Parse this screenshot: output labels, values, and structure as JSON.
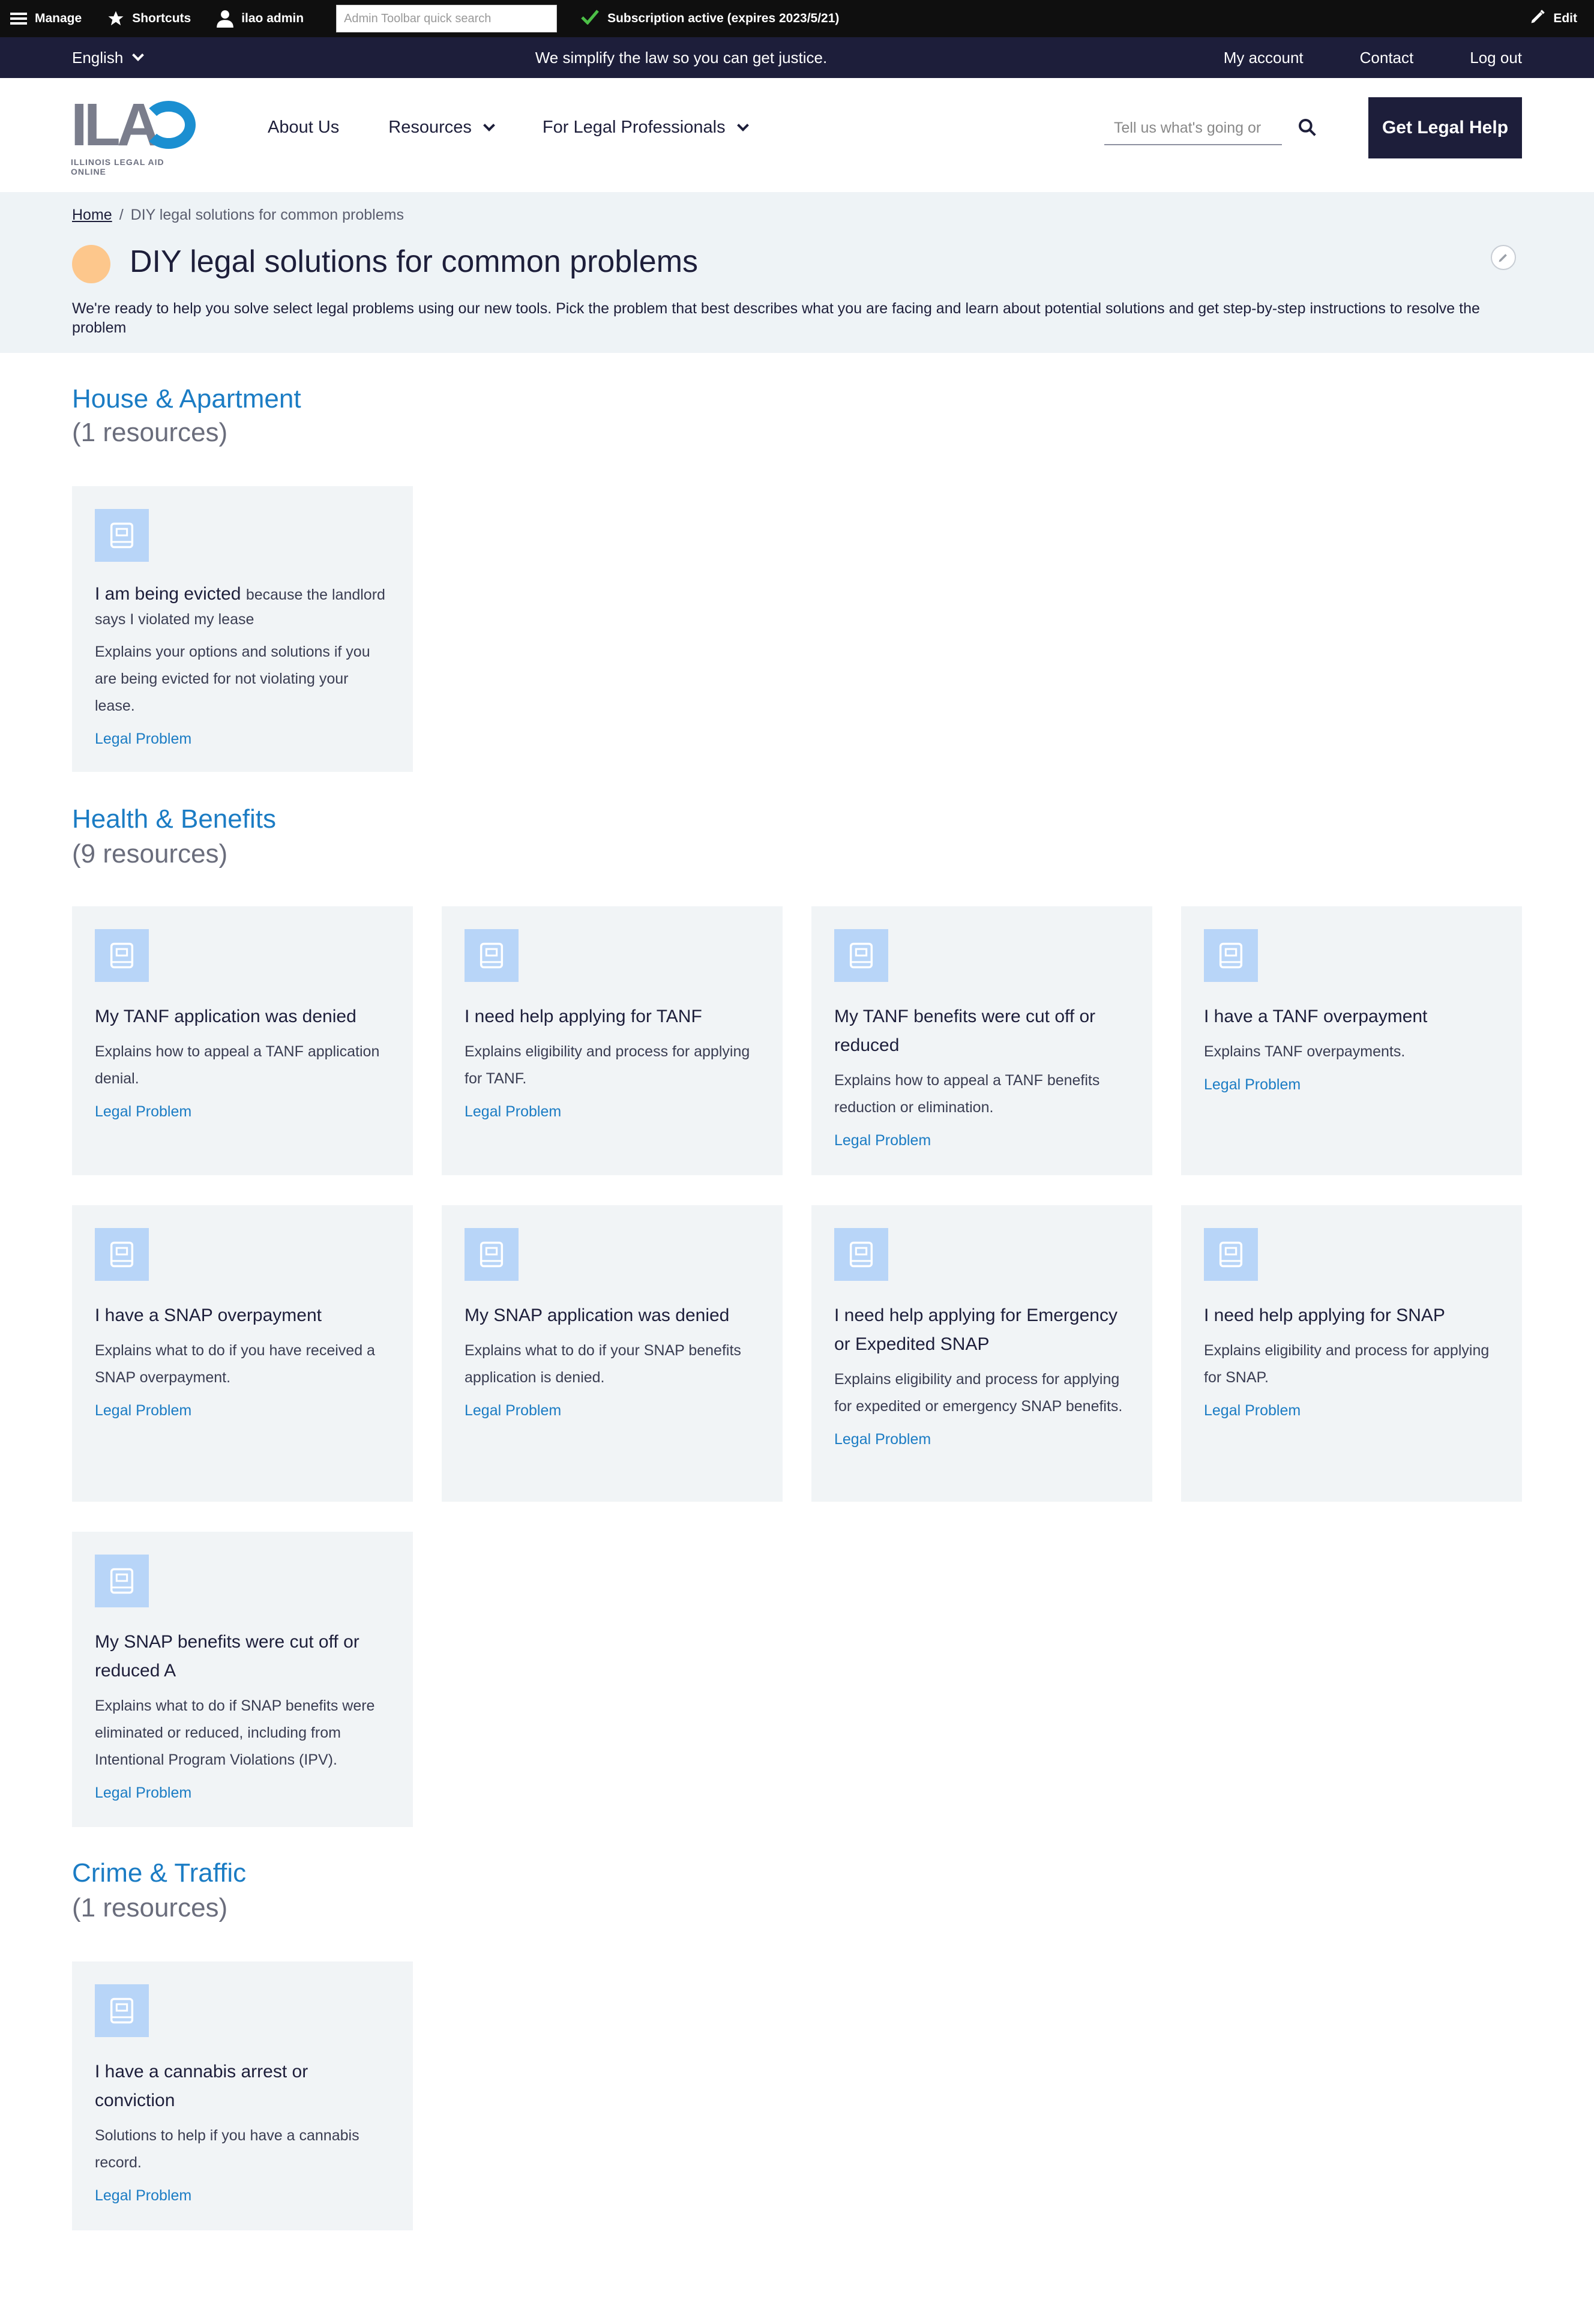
{
  "admin_toolbar": {
    "manage": "Manage",
    "shortcuts": "Shortcuts",
    "user": "ilao admin",
    "search_placeholder": "Admin Toolbar quick search",
    "subscription": "Subscription active (expires 2023/5/21)",
    "edit": "Edit"
  },
  "util_bar": {
    "language": "English",
    "tagline": "We simplify the law so you can get justice.",
    "links": [
      "My account",
      "Contact",
      "Log out"
    ]
  },
  "header": {
    "logo_mark": "ILA",
    "logo_sub": "ILLINOIS LEGAL AID ONLINE",
    "nav": [
      "About Us",
      "Resources",
      "For Legal Professionals"
    ],
    "search_placeholder": "Tell us what's going or",
    "cta": "Get Legal Help"
  },
  "hero": {
    "breadcrumb_home": "Home",
    "breadcrumb_sep": "/",
    "breadcrumb_current": "DIY legal solutions for common problems",
    "title": "DIY legal solutions for common problems",
    "description": "We're ready to help you solve select legal problems using our new tools. Pick the problem that best describes what you are facing and learn about potential solutions and get step-by-step instructions to resolve the problem"
  },
  "sections": [
    {
      "title": "House & Apartment",
      "count": "(1 resources)",
      "cards": [
        {
          "title": "I am being evicted",
          "title_small": "because the landlord says I violated my lease",
          "desc": "Explains your options and solutions if you are being evicted for not violating your lease.",
          "link": "Legal Problem"
        }
      ]
    },
    {
      "title": "Health & Benefits",
      "count": "(9 resources)",
      "cards": [
        {
          "title": "My TANF application was denied",
          "desc": "Explains how to appeal a TANF application denial.",
          "link": "Legal Problem"
        },
        {
          "title": "I need help applying for TANF",
          "desc": "Explains eligibility and process for applying for TANF.",
          "link": "Legal Problem"
        },
        {
          "title": "My TANF benefits were cut off or reduced",
          "desc": "Explains how to appeal a TANF benefits reduction or elimination.",
          "link": "Legal Problem"
        },
        {
          "title": "I have a TANF overpayment",
          "desc": "Explains TANF overpayments.",
          "link": "Legal Problem"
        },
        {
          "title": "I have a SNAP overpayment",
          "desc": "Explains what to do if you have received a SNAP overpayment.",
          "link": "Legal Problem"
        },
        {
          "title": "My SNAP application was denied",
          "desc": "Explains what to do if your SNAP benefits application is denied.",
          "link": "Legal Problem"
        },
        {
          "title": "I need help applying for Emergency or Expedited SNAP",
          "desc": "Explains eligibility and process for applying for expedited or emergency SNAP benefits.",
          "link": "Legal Problem"
        },
        {
          "title": "I need help applying for SNAP",
          "desc": "Explains eligibility and process for applying for SNAP.",
          "link": "Legal Problem"
        },
        {
          "title": "My SNAP benefits were cut off or reduced A",
          "desc": "Explains what to do if SNAP benefits were eliminated or reduced, including from Intentional Program Violations (IPV).",
          "link": "Legal Problem"
        }
      ]
    },
    {
      "title": "Crime & Traffic",
      "count": "(1 resources)",
      "cards": [
        {
          "title": "I have a cannabis arrest or conviction",
          "desc": "Solutions to help if you have a cannabis record.",
          "link": "Legal Problem"
        }
      ]
    }
  ],
  "icons": {
    "card_icon": "book-icon",
    "card_icon_bg": "#b8d5f8",
    "accent": "#1b7cc4",
    "navy": "#1d1e3a",
    "hero_dot": "#fdc78c"
  }
}
